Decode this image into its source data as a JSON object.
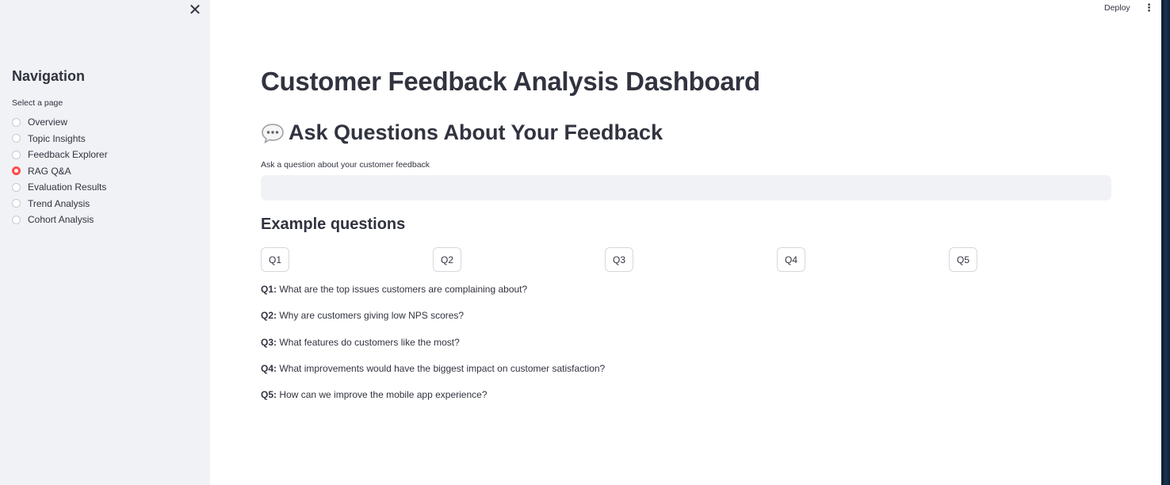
{
  "header": {
    "deploy_label": "Deploy",
    "menu_icon": "kebab-menu-icon"
  },
  "sidebar": {
    "close_icon": "close-icon",
    "title": "Navigation",
    "select_label": "Select a page",
    "selected": "RAG Q&A",
    "items": [
      {
        "label": "Overview"
      },
      {
        "label": "Topic Insights"
      },
      {
        "label": "Feedback Explorer"
      },
      {
        "label": "RAG Q&A"
      },
      {
        "label": "Evaluation Results"
      },
      {
        "label": "Trend Analysis"
      },
      {
        "label": "Cohort Analysis"
      }
    ]
  },
  "main": {
    "title": "Customer Feedback Analysis Dashboard",
    "section_icon": "speech-bubble-icon",
    "section_title": "Ask Questions About Your Feedback",
    "input_label": "Ask a question about your customer feedback",
    "input_value": "",
    "input_placeholder": "",
    "examples_title": "Example questions",
    "buttons": [
      "Q1",
      "Q2",
      "Q3",
      "Q4",
      "Q5"
    ],
    "questions": [
      {
        "key": "Q1:",
        "text": " What are the top issues customers are complaining about?"
      },
      {
        "key": "Q2:",
        "text": " Why are customers giving low NPS scores?"
      },
      {
        "key": "Q3:",
        "text": " What features do customers like the most?"
      },
      {
        "key": "Q4:",
        "text": " What improvements would have the biggest impact on customer satisfaction?"
      },
      {
        "key": "Q5:",
        "text": " How can we improve the mobile app experience?"
      }
    ]
  },
  "colors": {
    "sidebar_bg": "#f0f2f6",
    "accent": "#ff4b4b",
    "text": "#31333f"
  }
}
